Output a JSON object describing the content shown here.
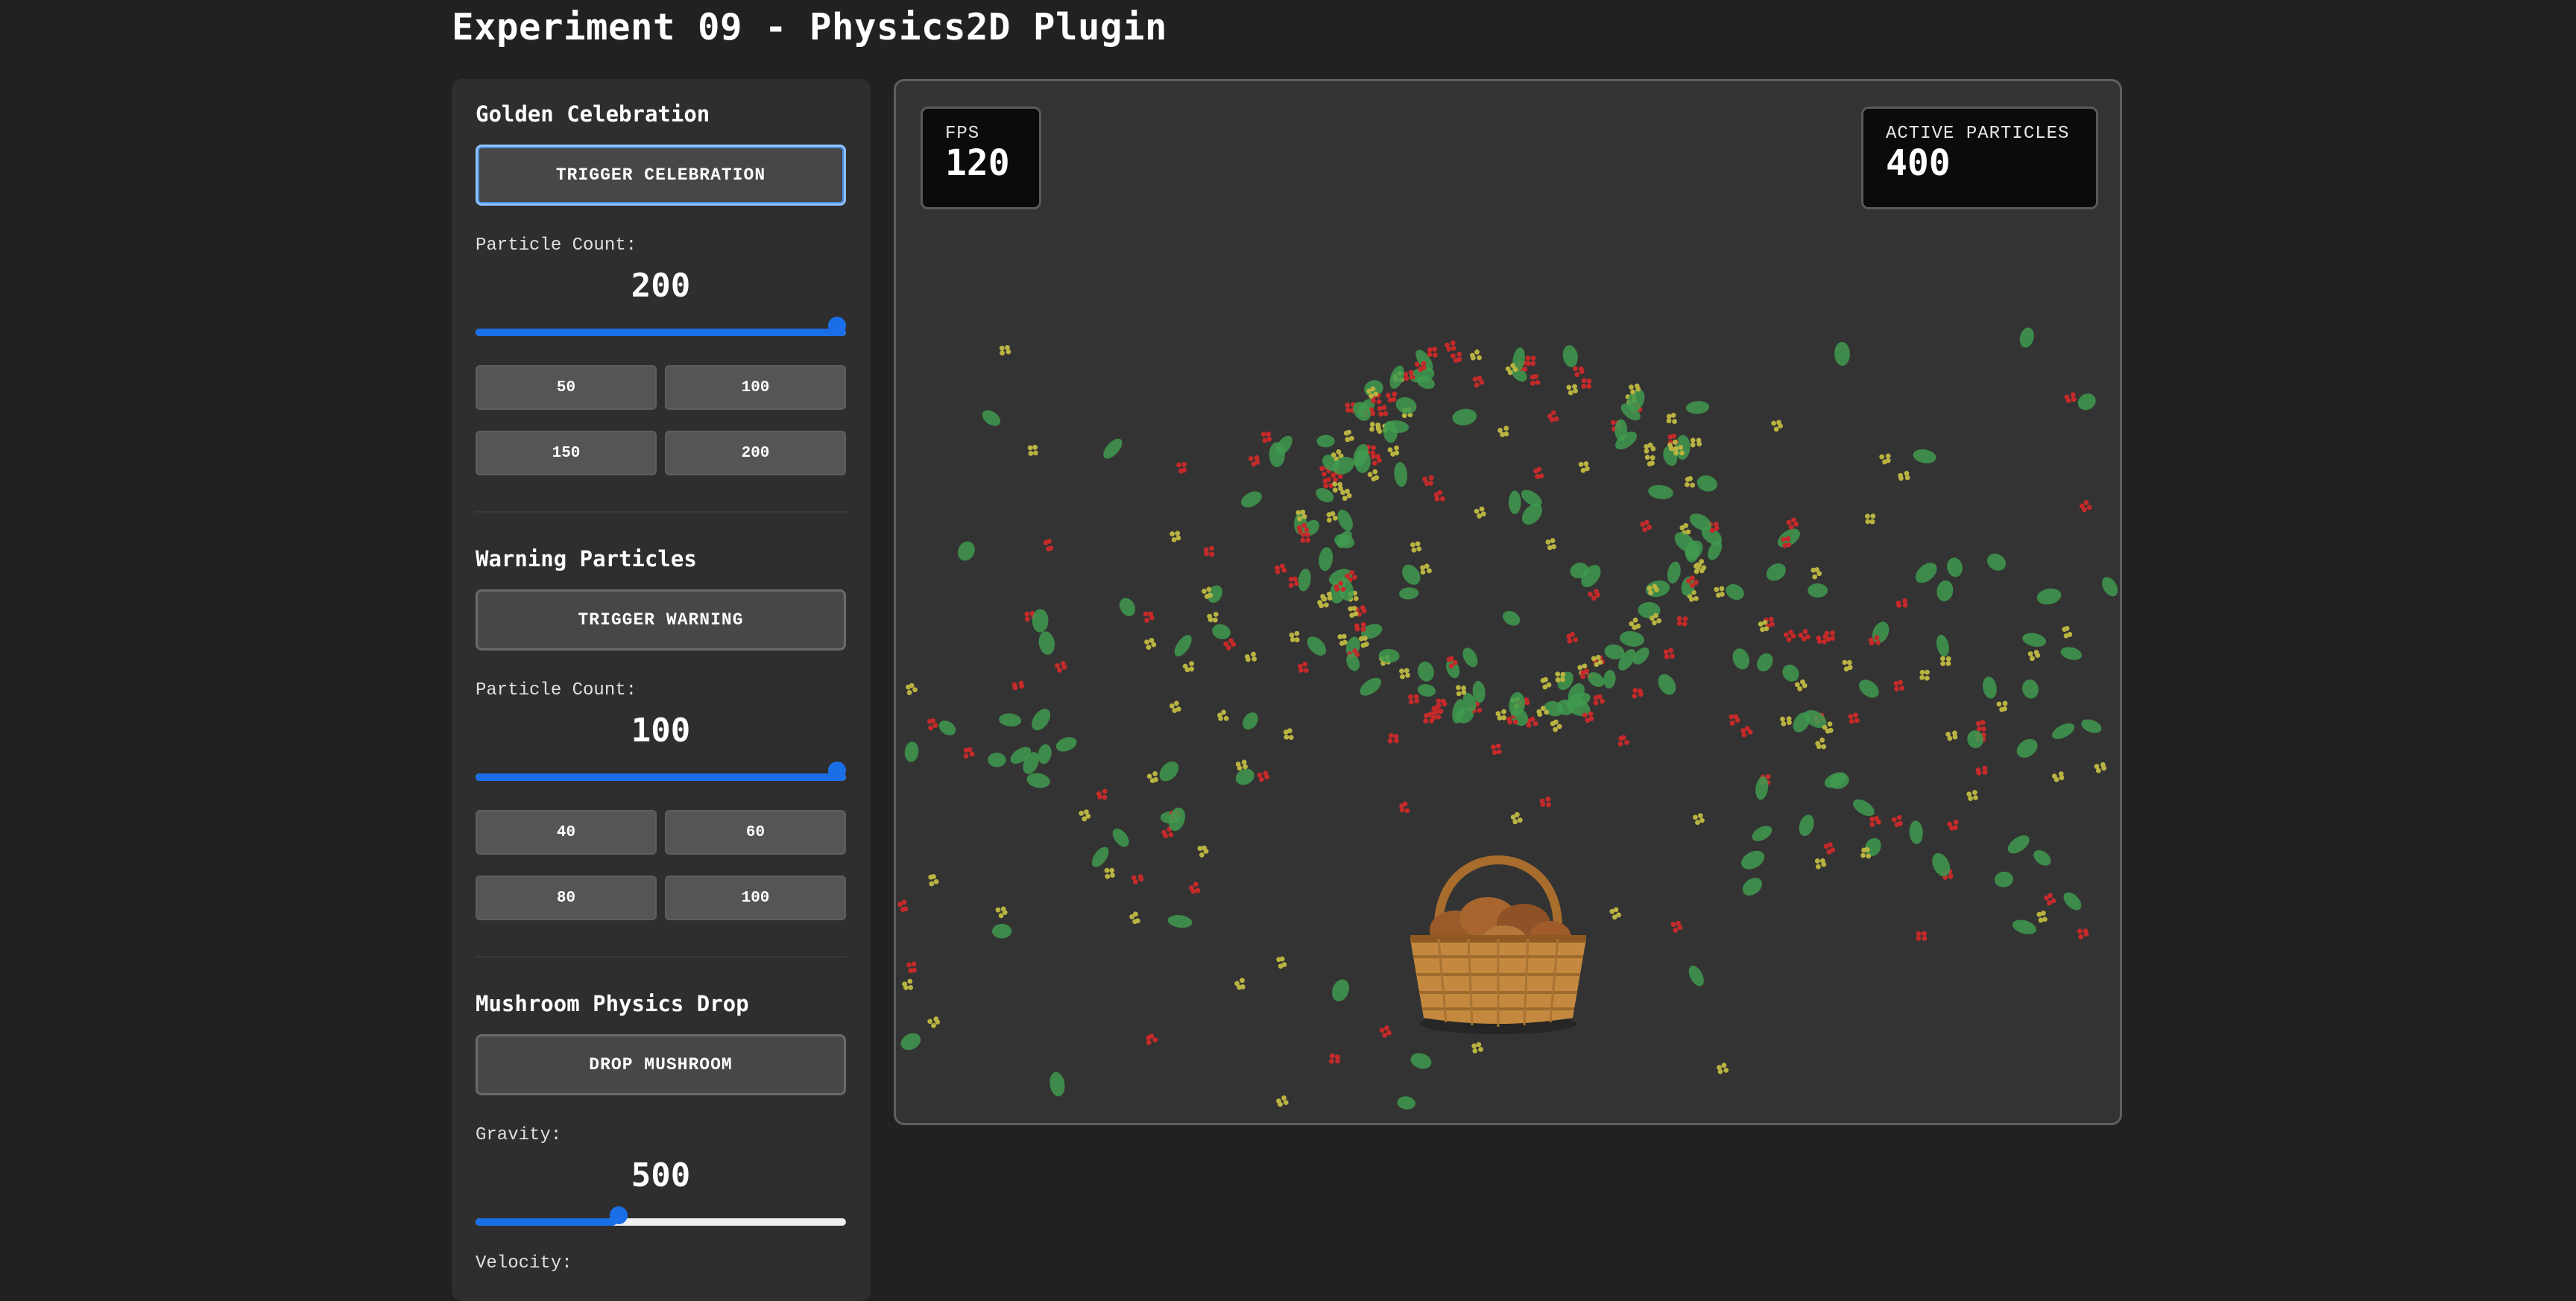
{
  "page": {
    "title": "Experiment 09 - Physics2D Plugin"
  },
  "controls": {
    "celebration": {
      "title": "Golden Celebration",
      "trigger_label": "TRIGGER CELEBRATION",
      "count_label": "Particle Count:",
      "count_value": "200",
      "slider_fraction": 1.0,
      "presets": [
        "50",
        "100",
        "150",
        "200"
      ]
    },
    "warning": {
      "title": "Warning Particles",
      "trigger_label": "TRIGGER WARNING",
      "count_label": "Particle Count:",
      "count_value": "100",
      "slider_fraction": 1.0,
      "presets": [
        "40",
        "60",
        "80",
        "100"
      ]
    },
    "mushroom": {
      "title": "Mushroom Physics Drop",
      "trigger_label": "DROP MUSHROOM",
      "gravity_label": "Gravity:",
      "gravity_value": "500",
      "gravity_fraction": 0.38,
      "velocity_label": "Velocity:"
    }
  },
  "stats": {
    "fps_label": "FPS",
    "fps_value": "120",
    "particles_label": "ACTIVE PARTICLES",
    "particles_value": "400"
  },
  "colors": {
    "accent": "#1a6fe8",
    "leaf": "#3f9a4f",
    "flower_yellow": "#b9b341",
    "particle_red": "#c42a2a",
    "basket": "#c4893e",
    "mushroom_cap": "#9a5a2a"
  },
  "icons": {
    "basket": "mushroom-basket-icon"
  }
}
